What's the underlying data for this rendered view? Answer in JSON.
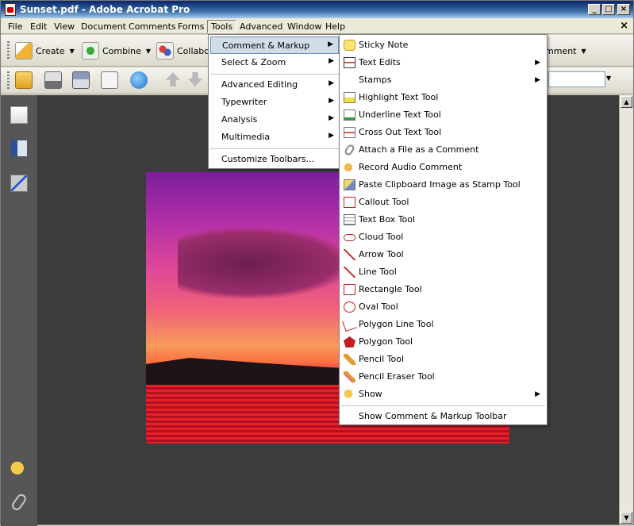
{
  "window": {
    "title": "Sunset.pdf - Adobe Acrobat Pro"
  },
  "menubar": {
    "items": [
      "File",
      "Edit",
      "View",
      "Document",
      "Comments",
      "Forms",
      "Tools",
      "Advanced",
      "Window",
      "Help"
    ],
    "active": "Tools",
    "close_glyph": "×"
  },
  "toolbar": {
    "create_label": "Create",
    "combine_label": "Combine",
    "collaborate_label": "Collabo",
    "comment_label": "mment"
  },
  "tools_menu": {
    "items": [
      {
        "label": "Comment & Markup",
        "submenu": true,
        "highlighted": true
      },
      {
        "label": "Select & Zoom",
        "submenu": true
      },
      {
        "label": "Advanced Editing",
        "submenu": true
      },
      {
        "label": "Typewriter",
        "submenu": true
      },
      {
        "label": "Analysis",
        "submenu": true
      },
      {
        "label": "Multimedia",
        "submenu": true
      },
      {
        "label": "Customize Toolbars...",
        "submenu": false
      }
    ]
  },
  "comment_markup_submenu": {
    "items": [
      {
        "label": "Sticky Note",
        "icon": "sticky-note-icon"
      },
      {
        "label": "Text Edits",
        "icon": "text-edits-icon",
        "submenu": true
      },
      {
        "label": "Stamps",
        "icon": "",
        "submenu": true
      },
      {
        "label": "Highlight Text Tool",
        "icon": "highlight-icon"
      },
      {
        "label": "Underline Text Tool",
        "icon": "underline-icon"
      },
      {
        "label": "Cross Out Text Tool",
        "icon": "cross-out-icon"
      },
      {
        "label": "Attach a File as a Comment",
        "icon": "attach-file-icon"
      },
      {
        "label": "Record Audio Comment",
        "icon": "audio-icon"
      },
      {
        "label": "Paste Clipboard Image as Stamp Tool",
        "icon": "paste-stamp-icon"
      },
      {
        "label": "Callout Tool",
        "icon": "callout-icon"
      },
      {
        "label": "Text Box Tool",
        "icon": "text-box-icon"
      },
      {
        "label": "Cloud Tool",
        "icon": "cloud-icon"
      },
      {
        "label": "Arrow Tool",
        "icon": "arrow-icon"
      },
      {
        "label": "Line Tool",
        "icon": "line-icon"
      },
      {
        "label": "Rectangle Tool",
        "icon": "rectangle-icon"
      },
      {
        "label": "Oval Tool",
        "icon": "oval-icon"
      },
      {
        "label": "Polygon Line Tool",
        "icon": "polygon-line-icon"
      },
      {
        "label": "Polygon Tool",
        "icon": "polygon-icon"
      },
      {
        "label": "Pencil Tool",
        "icon": "pencil-icon"
      },
      {
        "label": "Pencil Eraser Tool",
        "icon": "pencil-eraser-icon"
      },
      {
        "label": "Show",
        "icon": "show-icon",
        "submenu": true
      }
    ],
    "footer_label": "Show Comment & Markup Toolbar"
  },
  "document": {
    "image_name": "sunset-image"
  }
}
